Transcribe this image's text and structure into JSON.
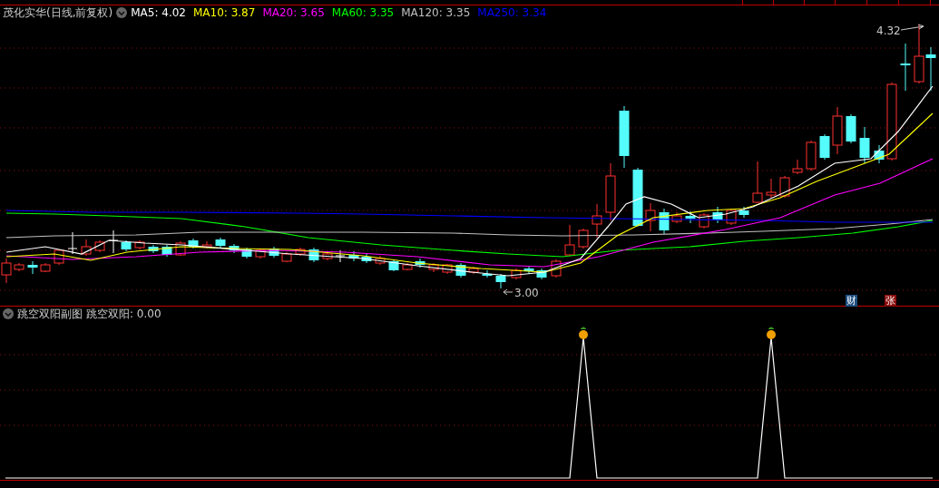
{
  "header": {
    "title": "茂化实华(日线,前复权)",
    "indicators": [
      {
        "label": "MA5: 4.02",
        "color": "#ffffff"
      },
      {
        "label": "MA10: 3.87",
        "color": "#ffff00"
      },
      {
        "label": "MA20: 3.65",
        "color": "#ff00ff"
      },
      {
        "label": "MA60: 3.35",
        "color": "#00ff00"
      },
      {
        "label": "MA120: 3.35",
        "color": "#c0c0c0"
      },
      {
        "label": "MA250: 3.34",
        "color": "#0000ff"
      }
    ]
  },
  "price_chart": {
    "high_label": "4.32",
    "low_label": "3.00",
    "markers": [
      {
        "label": "财",
        "color": "#1d4e80"
      },
      {
        "label": "张",
        "color": "#8a0a0a"
      }
    ]
  },
  "sub_chart": {
    "title": "跳空双阳副图",
    "indicator": "跳空双阳: 0.00"
  }
}
